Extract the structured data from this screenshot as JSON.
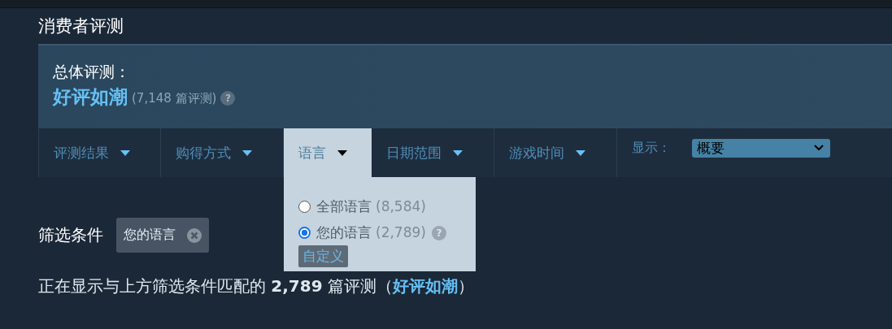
{
  "section_title": "消费者评测",
  "overall": {
    "label": "总体评测：",
    "rating": "好评如潮",
    "count": "(7,148 篇评测)",
    "help": "?"
  },
  "filter_tabs": [
    {
      "label": "评测结果",
      "selected": false
    },
    {
      "label": "购得方式",
      "selected": false
    },
    {
      "label": "语言",
      "selected": true
    },
    {
      "label": "日期范围",
      "selected": false
    },
    {
      "label": "游戏时间",
      "selected": false
    }
  ],
  "display": {
    "label": "显示：",
    "value": "概要"
  },
  "language_menu": {
    "options": [
      {
        "label": "全部语言",
        "count": "(8,584)",
        "selected": false,
        "help": false
      },
      {
        "label": "您的语言",
        "count": "(2,789)",
        "selected": true,
        "help": true
      }
    ],
    "help": "?",
    "custom_button": "自定义"
  },
  "active_filters": {
    "label": "筛选条件",
    "chips": [
      "您的语言"
    ]
  },
  "summary": {
    "prefix": "正在显示与上方筛选条件匹配的 **2,789** 篇评测（",
    "rating": "好评如潮",
    "suffix": "）"
  }
}
